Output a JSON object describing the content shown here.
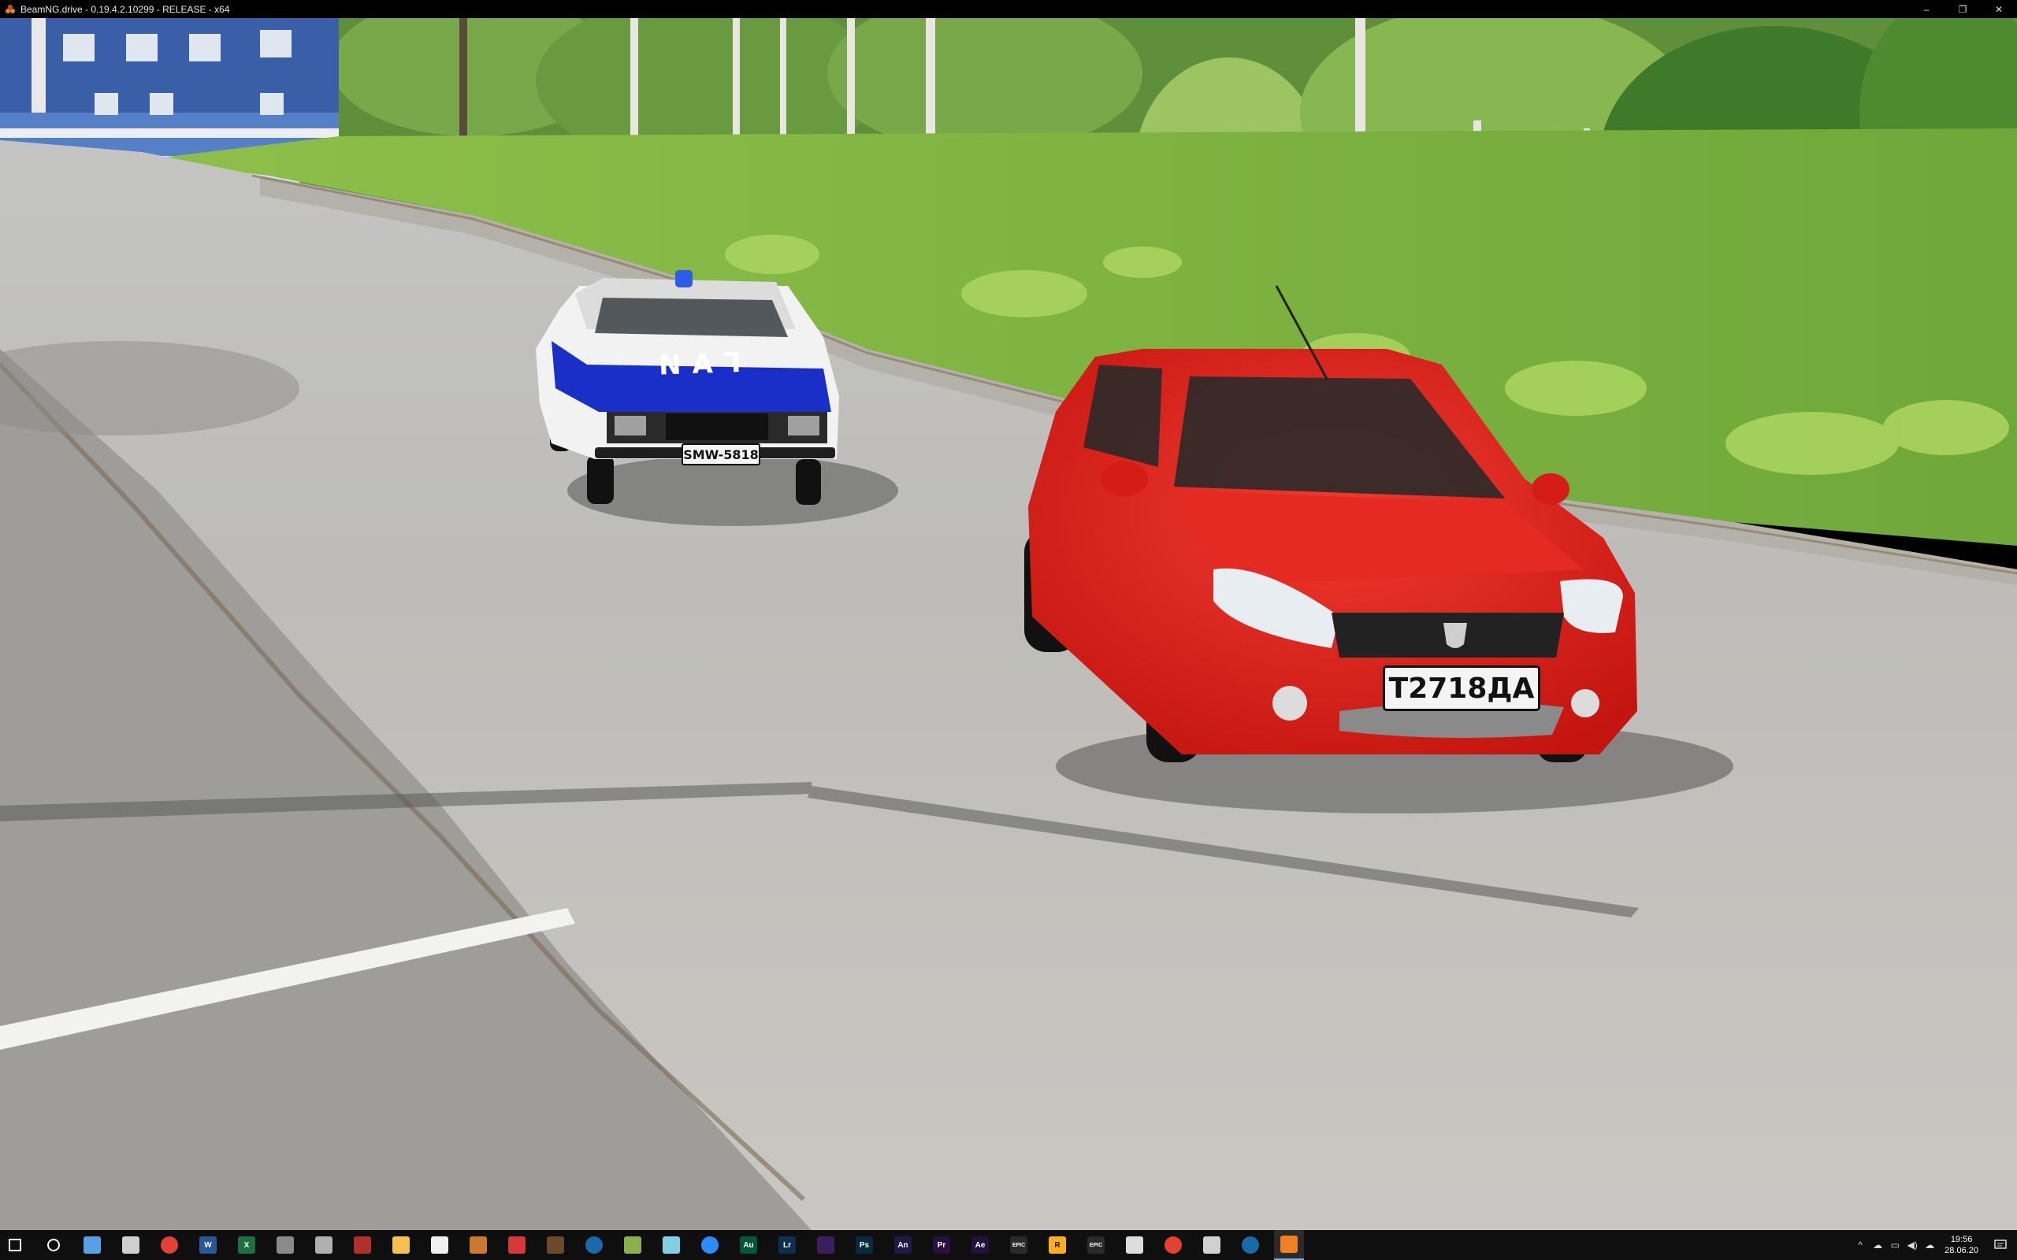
{
  "window": {
    "title": "BeamNG.drive - 0.19.4.2.10299 - RELEASE - x64",
    "controls": [
      "–",
      "❐",
      "✕"
    ]
  },
  "scene": {
    "police_car": {
      "door_text": "ГАИ",
      "plate": "SMW-5818",
      "body_color": "#f2f2f2",
      "stripe_color": "#1a2fc8"
    },
    "red_car": {
      "plate": "T2718ДА",
      "body_color": "#e01e1e"
    }
  },
  "taskbar": {
    "items": [
      {
        "name": "start",
        "label": "",
        "color": "#ffffff"
      },
      {
        "name": "search",
        "label": "",
        "color": "#ffffff"
      },
      {
        "name": "explorer-window",
        "label": "",
        "color": "#5aa0e0"
      },
      {
        "name": "calculator",
        "label": "",
        "color": "#cfcfcf"
      },
      {
        "name": "chrome",
        "label": "",
        "color": "#e34133"
      },
      {
        "name": "word",
        "label": "W",
        "color": "#2b5797"
      },
      {
        "name": "excel",
        "label": "X",
        "color": "#1d7044"
      },
      {
        "name": "app-gray-1",
        "label": "",
        "color": "#8a8a8a"
      },
      {
        "name": "app-gray-2",
        "label": "",
        "color": "#b0b0b0"
      },
      {
        "name": "app-pin",
        "label": "",
        "color": "#b0302a"
      },
      {
        "name": "file-explorer",
        "label": "",
        "color": "#f2c14e"
      },
      {
        "name": "notepad",
        "label": "",
        "color": "#f0f0f0"
      },
      {
        "name": "app-tools",
        "label": "",
        "color": "#c87a30"
      },
      {
        "name": "app-red",
        "label": "",
        "color": "#d23a3a"
      },
      {
        "name": "minecraft",
        "label": "",
        "color": "#6b4a2a"
      },
      {
        "name": "steam",
        "label": "",
        "color": "#1b6aa8"
      },
      {
        "name": "app-build",
        "label": "",
        "color": "#8bb04a"
      },
      {
        "name": "app-cyan",
        "label": "",
        "color": "#7fd0e0"
      },
      {
        "name": "zoom",
        "label": "",
        "color": "#2d8cff"
      },
      {
        "name": "audition",
        "label": "Au",
        "color": "#00583a"
      },
      {
        "name": "lightroom",
        "label": "Lr",
        "color": "#0d2f4d"
      },
      {
        "name": "media-encoder",
        "label": "",
        "color": "#3a1f5c"
      },
      {
        "name": "photoshop",
        "label": "Ps",
        "color": "#0b2a40"
      },
      {
        "name": "animate",
        "label": "An",
        "color": "#1c1a46"
      },
      {
        "name": "premiere",
        "label": "Pr",
        "color": "#2a0f3f"
      },
      {
        "name": "after-effects",
        "label": "Ae",
        "color": "#23103f"
      },
      {
        "name": "epic-games-1",
        "label": "EPIC",
        "color": "#2a2a2a"
      },
      {
        "name": "rockstar",
        "label": "R",
        "color": "#fcaf17"
      },
      {
        "name": "epic-games-2",
        "label": "EPIC",
        "color": "#2a2a2a"
      },
      {
        "name": "app-g",
        "label": "",
        "color": "#dddddd"
      },
      {
        "name": "chrome-2",
        "label": "",
        "color": "#e34133"
      },
      {
        "name": "app-box",
        "label": "",
        "color": "#d0d0d0"
      },
      {
        "name": "steam-2",
        "label": "",
        "color": "#1b6aa8"
      },
      {
        "name": "beamng",
        "label": "",
        "color": "#f08020"
      }
    ],
    "tray_icons": [
      "^",
      "☁",
      "▭",
      "◀)",
      "☁"
    ],
    "clock": {
      "time": "19:56",
      "date": "28.06.20"
    }
  }
}
